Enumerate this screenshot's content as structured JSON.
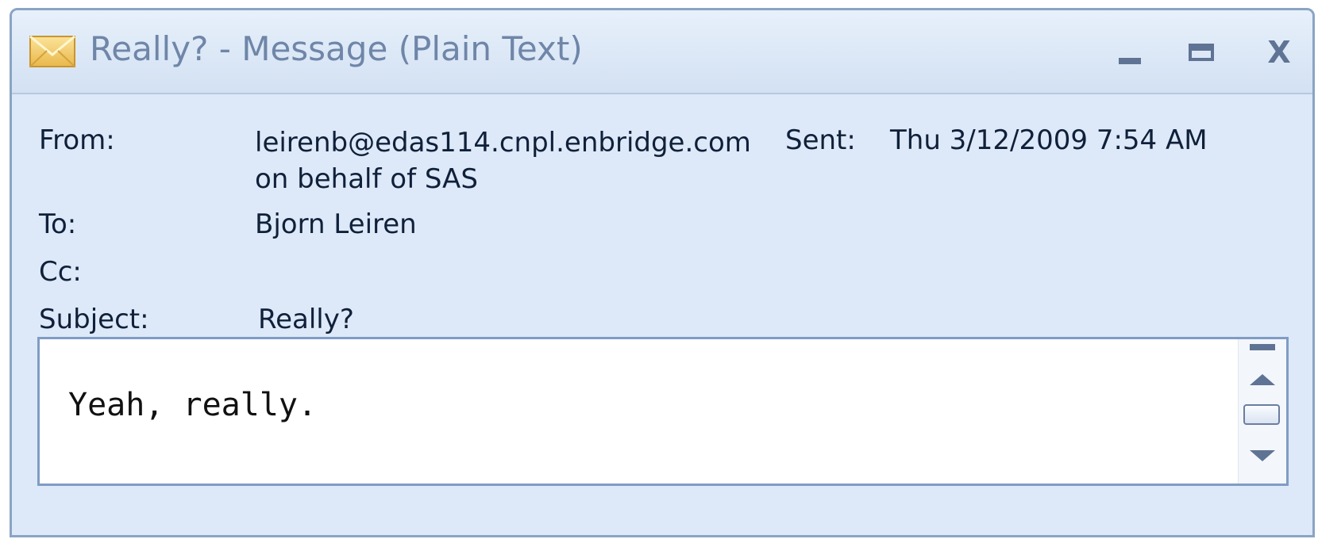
{
  "window": {
    "title": "Really? - Message (Plain Text)",
    "icon": "envelope-icon",
    "controls": {
      "minimize": "minimize-icon",
      "maximize": "maximize-icon",
      "close_label": "X"
    }
  },
  "message": {
    "from_label": "From:",
    "from_line1": "leirenb@edas114.cnpl.enbridge.com",
    "from_line2": "on behalf of SAS",
    "sent_label": "Sent:",
    "sent_value": "Thu 3/12/2009 7:54 AM",
    "to_label": "To:",
    "to_value": "Bjorn Leiren",
    "cc_label": "Cc:",
    "subject_label": "Subject:",
    "subject_value": "Really?",
    "body": "Yeah, really."
  },
  "colors": {
    "window_bg": "#dde9f8",
    "title_text": "#6f86a8",
    "border": "#8aa4c4"
  }
}
